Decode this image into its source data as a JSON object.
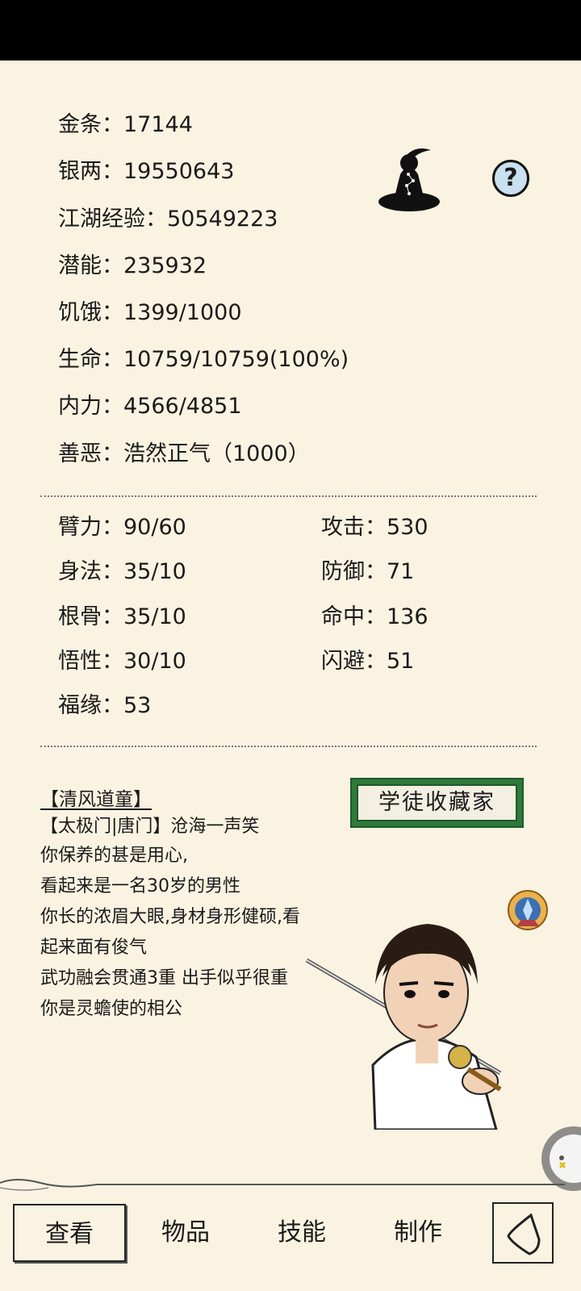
{
  "stats": {
    "gold": {
      "label": "金条：",
      "value": "17144"
    },
    "silver": {
      "label": "银两：",
      "value": "19550643"
    },
    "exp": {
      "label": "江湖经验：",
      "value": "50549223"
    },
    "potential": {
      "label": "潜能：",
      "value": "235932"
    },
    "hunger": {
      "label": "饥饿：",
      "value": "1399/1000"
    },
    "hp": {
      "label": "生命：",
      "value": "10759/10759(100%)"
    },
    "mp": {
      "label": "内力：",
      "value": "4566/4851"
    },
    "morality": {
      "label": "善恶：",
      "value": "浩然正气（1000）"
    }
  },
  "attributes": {
    "strength": {
      "label": "臂力：",
      "value": "90/60"
    },
    "agility": {
      "label": "身法：",
      "value": "35/10"
    },
    "constitution": {
      "label": "根骨：",
      "value": "35/10"
    },
    "intelligence": {
      "label": "悟性：",
      "value": "30/10"
    },
    "luck": {
      "label": "福缘：",
      "value": "53"
    },
    "attack": {
      "label": "攻击：",
      "value": "530"
    },
    "defense": {
      "label": "防御：",
      "value": "71"
    },
    "accuracy": {
      "label": "命中：",
      "value": "136"
    },
    "evasion": {
      "label": "闪避：",
      "value": "51"
    }
  },
  "help_button": {
    "label": "?"
  },
  "profile": {
    "title": "【清风道童】",
    "badge": "学徒收藏家",
    "lines": [
      "【太极门|唐门】沧海一声笑",
      "你保养的甚是用心,",
      "看起来是一名30岁的男性",
      "你长的浓眉大眼,身材身形健硕,看",
      "起来面有俊气",
      "武功融会贯通3重 出手似乎很重",
      "你是灵蟾使的相公"
    ]
  },
  "icons": {
    "meditate": "meditation-figure-icon",
    "help": "question-mark-icon",
    "medal": "medal-icon",
    "back": "back-arrow-icon",
    "floating": "floating-assistant-icon"
  },
  "nav": {
    "items": [
      "查看",
      "物品",
      "技能",
      "制作"
    ],
    "selected": "查看"
  }
}
